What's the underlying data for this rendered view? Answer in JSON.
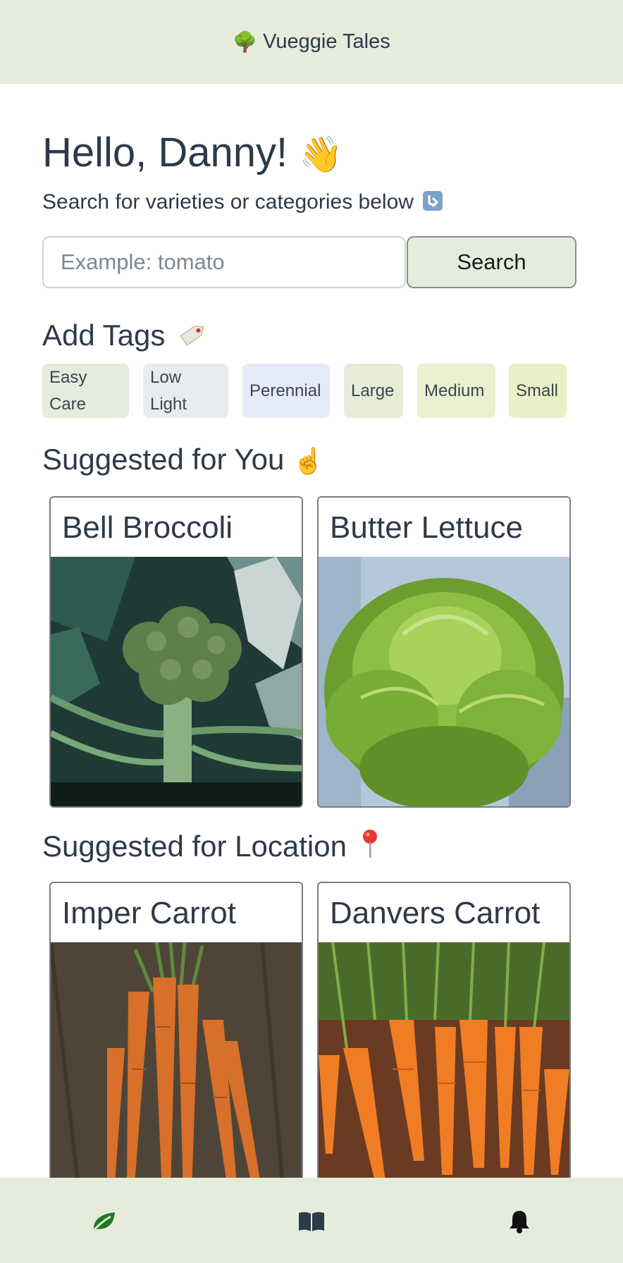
{
  "app": {
    "title": "Vueggie Tales",
    "logo_icon": "tree-icon"
  },
  "greeting": {
    "text": "Hello, Danny!",
    "emoji_icon": "waving-hand-icon"
  },
  "subtitle": {
    "text": "Search for varieties or categories below",
    "icon": "down-arrow-box-icon"
  },
  "search": {
    "placeholder": "Example: tomato",
    "value": "",
    "button_label": "Search"
  },
  "tags": {
    "title": "Add Tags",
    "icon": "tag-label-icon",
    "items": [
      {
        "label": "Easy Care",
        "color": "#e6ecdc"
      },
      {
        "label": "Low Light",
        "color": "#e8ecee"
      },
      {
        "label": "Perennial",
        "color": "#e6ebfa"
      },
      {
        "label": "Large",
        "color": "#e6ecd6"
      },
      {
        "label": "Medium",
        "color": "#eaf0d0"
      },
      {
        "label": "Small",
        "color": "#eaf0c6"
      }
    ]
  },
  "suggested_for_you": {
    "title": "Suggested for You",
    "icon": "pointing-up-hand-icon",
    "cards": [
      {
        "name": "Bell Broccoli",
        "image": "broccoli-photo"
      },
      {
        "name": "Butter Lettuce",
        "image": "lettuce-photo"
      }
    ]
  },
  "suggested_for_location": {
    "title": "Suggested for Location",
    "icon": "map-pin-icon",
    "cards": [
      {
        "name": "Imper Carrot",
        "image": "carrot-bunch-photo"
      },
      {
        "name": "Danvers Carrot",
        "image": "carrots-row-photo"
      }
    ]
  },
  "bottom_nav": {
    "items": [
      {
        "icon": "leaf-icon",
        "active": true,
        "color": "#1f7a1f"
      },
      {
        "icon": "book-icon",
        "active": false,
        "color": "#2d3a4a"
      },
      {
        "icon": "bell-icon",
        "active": false,
        "color": "#111111"
      }
    ]
  },
  "colors": {
    "header_bg": "#e6ecdc",
    "text": "#2d3a4a",
    "accent": "#1f7a1f"
  }
}
